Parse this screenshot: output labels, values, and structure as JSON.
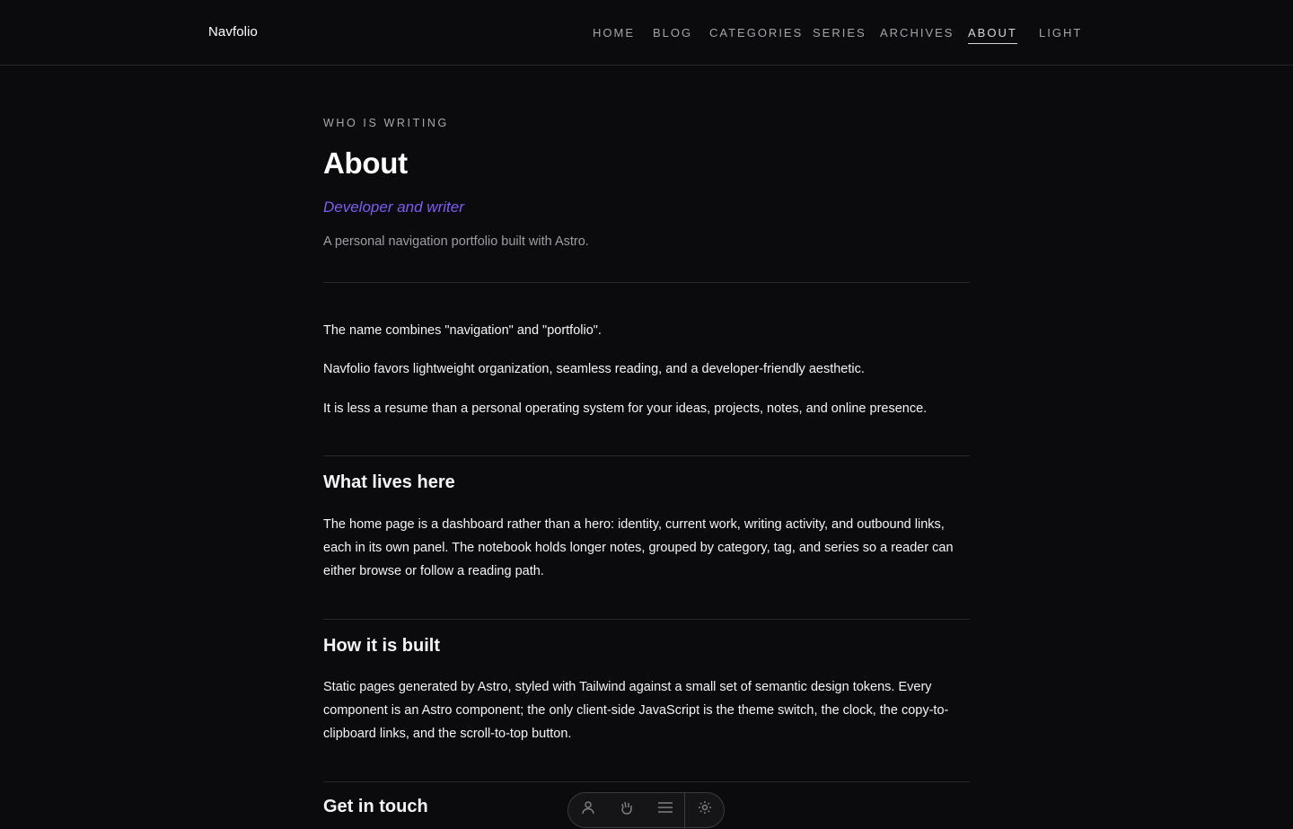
{
  "site": {
    "brand": "Navfolio"
  },
  "nav": {
    "items": [
      {
        "label": "HOME"
      },
      {
        "label": "BLOG"
      },
      {
        "label": "CATEGORIES"
      },
      {
        "label": "SERIES"
      },
      {
        "label": "ARCHIVES"
      },
      {
        "label": "ABOUT",
        "active": true
      }
    ],
    "theme_toggle": "LIGHT"
  },
  "page": {
    "eyebrow": "WHO IS WRITING",
    "title": "About",
    "tagline": "Developer and writer",
    "summary": "A personal navigation portfolio built with Astro."
  },
  "intro": {
    "paragraphs": [
      "The name combines \"navigation\" and \"portfolio\".",
      "Navfolio favors lightweight organization, seamless reading, and a developer-friendly aesthetic.",
      "It is less a resume than a personal operating system for your ideas, projects, notes, and online presence."
    ]
  },
  "sections": [
    {
      "heading": "What lives here",
      "body": "The home page is a dashboard rather than a hero: identity, current work, writing activity, and outbound links, each in its own panel. The notebook holds longer notes, grouped by category, tag, and series so a reader can either browse or follow a reading path."
    },
    {
      "heading": "How it is built",
      "body": "Static pages generated by Astro, styled with Tailwind against a small set of semantic design tokens. Every component is an Astro component; the only client-side JavaScript is the theme switch, the clock, the copy-to-clipboard links, and the scroll-to-top button."
    },
    {
      "heading": "Get in touch"
    }
  ],
  "toolbar": {
    "icons": [
      "person-icon",
      "hand-wave-icon",
      "menu-icon",
      "settings-icon"
    ]
  },
  "colors": {
    "background": "#0b0b0d",
    "accent": "#7c5cf4",
    "text": "#f4f4f6",
    "muted": "#9d9da4",
    "divider": "#26262b"
  }
}
